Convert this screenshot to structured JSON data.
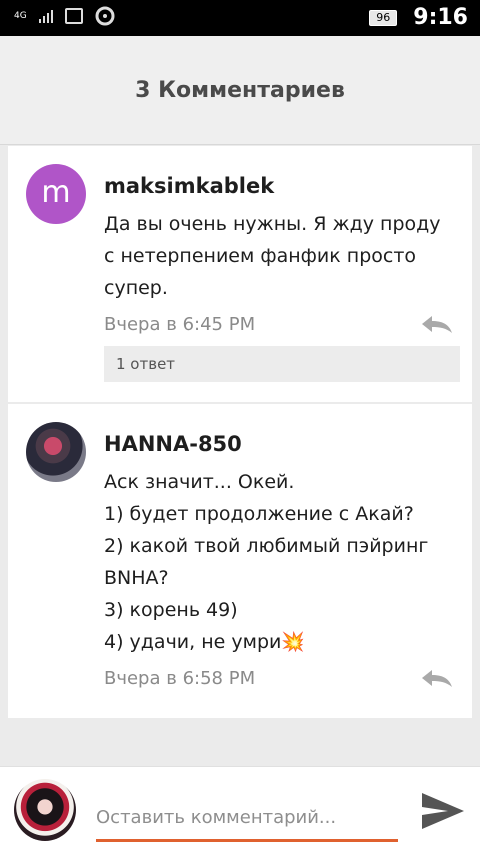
{
  "status_bar": {
    "network": "4G",
    "battery": "96",
    "time": "9:16"
  },
  "header": {
    "title": "3 Комментариев"
  },
  "comments": [
    {
      "avatar_letter": "m",
      "avatar_color": "#b055c8",
      "author": "maksimkablek",
      "text_lines": [
        "Да вы очень нужны. Я жду проду",
        "с нетерпением фанфик просто",
        "супер."
      ],
      "timestamp": "Вчера в 6:45 PM",
      "replies_label": "1 ответ"
    },
    {
      "author": "HANNA-850",
      "text_lines": [
        "Аск значит... Окей.",
        "1) будет продолжение с Акай?",
        "2) какой твой любимый пэйринг",
        "BNHA?",
        "3) корень 49)",
        "4) удачи, не умри💥"
      ],
      "timestamp": "Вчера в 6:58 PM"
    }
  ],
  "footer": {
    "input_placeholder": "Оставить комментарий...",
    "accent_color": "#e0612f"
  }
}
